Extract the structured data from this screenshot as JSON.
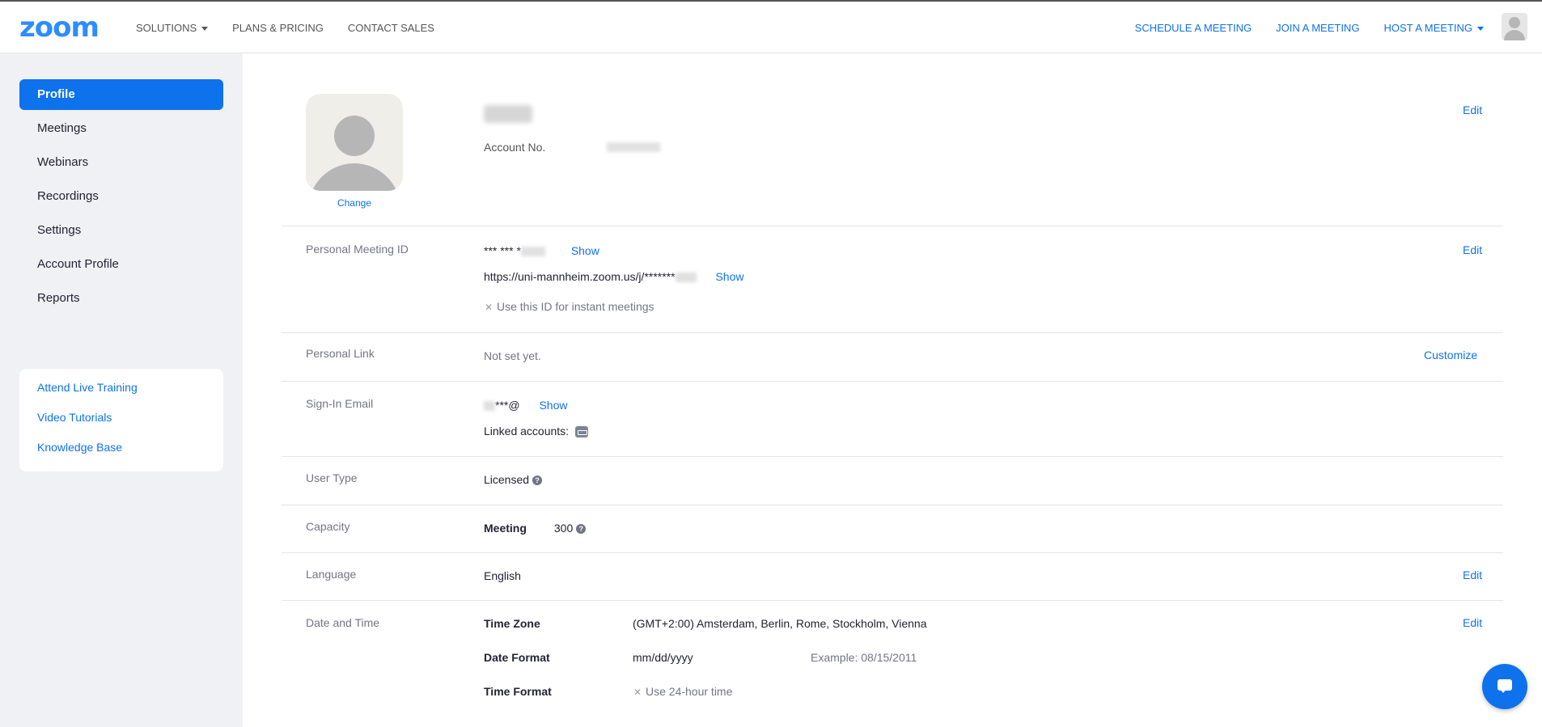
{
  "brand": {
    "logo": "zoom",
    "accent": "#0e72ed",
    "logo_color": "#2d8cff"
  },
  "topnav": {
    "left": [
      {
        "label": "SOLUTIONS",
        "has_caret": true
      },
      {
        "label": "PLANS & PRICING"
      },
      {
        "label": "CONTACT SALES"
      }
    ],
    "right": [
      {
        "label": "SCHEDULE A MEETING"
      },
      {
        "label": "JOIN A MEETING"
      },
      {
        "label": "HOST A MEETING",
        "has_caret": true
      }
    ]
  },
  "sidebar": {
    "items": [
      {
        "label": "Profile",
        "active": true
      },
      {
        "label": "Meetings"
      },
      {
        "label": "Webinars"
      },
      {
        "label": "Recordings"
      },
      {
        "label": "Settings"
      },
      {
        "label": "Account Profile"
      },
      {
        "label": "Reports"
      }
    ],
    "help": [
      {
        "label": "Attend Live Training"
      },
      {
        "label": "Video Tutorials"
      },
      {
        "label": "Knowledge Base"
      }
    ]
  },
  "profile": {
    "change_label": "Change",
    "account_no_label": "Account No.",
    "edit_label": "Edit"
  },
  "rows": {
    "pmi": {
      "label": "Personal Meeting ID",
      "masked_id": "*** *** *",
      "show_label": "Show",
      "url": "https://uni-mannheim.zoom.us/j/*******",
      "url_show_label": "Show",
      "instant_note": "Use this ID for instant meetings",
      "edit_label": "Edit"
    },
    "personal_link": {
      "label": "Personal Link",
      "value": "Not set yet.",
      "action_label": "Customize"
    },
    "signin_email": {
      "label": "Sign-In Email",
      "masked": "***@",
      "show_label": "Show",
      "linked_label": "Linked accounts:"
    },
    "user_type": {
      "label": "User Type",
      "value": "Licensed"
    },
    "capacity": {
      "label": "Capacity",
      "meeting_label": "Meeting",
      "meeting_value": "300"
    },
    "language": {
      "label": "Language",
      "value": "English",
      "edit_label": "Edit"
    },
    "date_time": {
      "label": "Date and Time",
      "edit_label": "Edit",
      "time_zone_label": "Time Zone",
      "time_zone_value": "(GMT+2:00) Amsterdam, Berlin, Rome, Stockholm, Vienna",
      "date_format_label": "Date Format",
      "date_format_value": "mm/dd/yyyy",
      "example_label": "Example:",
      "example_value": "08/15/2011",
      "time_format_label": "Time Format",
      "time_format_value": "Use 24-hour time"
    }
  }
}
